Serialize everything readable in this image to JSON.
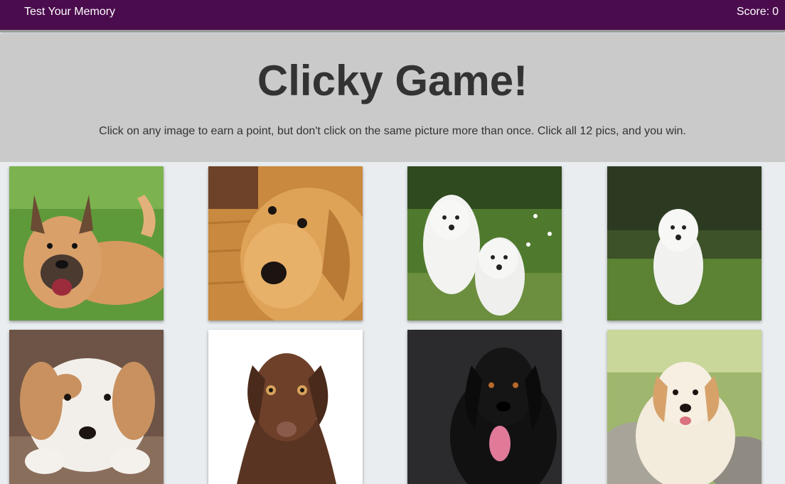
{
  "navbar": {
    "brand": "Test Your Memory",
    "score_label": "Score:",
    "score": "0",
    "bg_color": "#4b0c4e"
  },
  "jumbotron": {
    "title": "Clicky Game!",
    "instructions": "Click on any image to earn a point, but don't click on the same picture more than once. Click all 12 pics, and you win."
  },
  "cards": [
    {
      "icon": "shepherd-mix-dog-photo"
    },
    {
      "icon": "golden-retriever-photo"
    },
    {
      "icon": "two-white-puppies-photo"
    },
    {
      "icon": "white-puppy-in-grass-photo"
    },
    {
      "icon": "cavapoo-puppy-photo"
    },
    {
      "icon": "chocolate-lab-puppy-photo"
    },
    {
      "icon": "black-dog-photo"
    },
    {
      "icon": "golden-puppy-photo"
    }
  ]
}
